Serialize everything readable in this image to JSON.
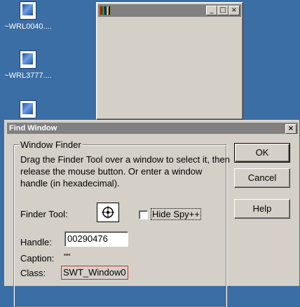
{
  "desktop": {
    "icons": [
      {
        "label": "~WRL0040....",
        "icon": "document-icon"
      },
      {
        "label": "~WRL3777....",
        "icon": "document-icon"
      },
      {
        "label": "",
        "icon": "document-icon"
      }
    ]
  },
  "bg_window": {
    "title": "",
    "buttons": {
      "minimize": "_",
      "maximize": "□",
      "close": "×"
    }
  },
  "dialog": {
    "title": "Find Window",
    "close": "×",
    "group_label": "Window Finder",
    "instructions": "Drag the Finder Tool over a window to select it, then release the mouse button.  Or enter a window handle (in hexadecimal).",
    "finder_tool_label": "Finder Tool:",
    "hide_spy_label": "Hide Spy++",
    "handle_label": "Handle:",
    "handle_value": "00290476",
    "caption_label": "Caption:",
    "caption_value": "\"\"",
    "class_label": "Class:",
    "class_value": "SWT_Window0",
    "buttons": {
      "ok": "OK",
      "cancel": "Cancel",
      "help": "Help"
    }
  }
}
